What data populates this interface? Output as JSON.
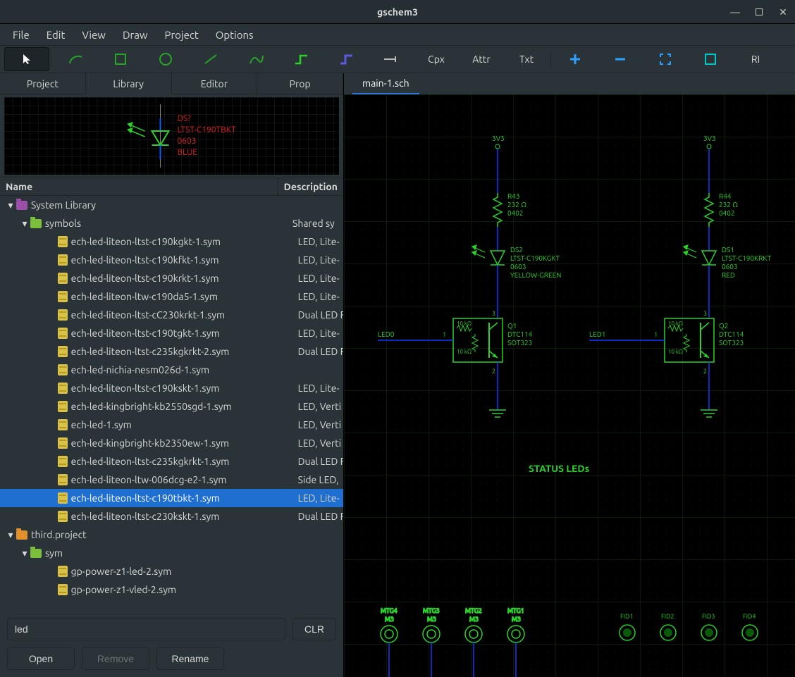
{
  "window": {
    "title": "gschem3"
  },
  "menu": [
    "File",
    "Edit",
    "View",
    "Draw",
    "Project",
    "Options"
  ],
  "toolbar_text": {
    "cpx": "Cpx",
    "attr": "Attr",
    "txt": "Txt",
    "ri": "RI"
  },
  "left_tabs": [
    "Project",
    "Library",
    "Editor",
    "Prop"
  ],
  "active_left_tab": 1,
  "preview": {
    "refdes": "DS?",
    "part": "LTST-C190TBKT",
    "footprint": "0603",
    "color": "BLUE"
  },
  "tree_columns": [
    "Name",
    "Description"
  ],
  "tree": [
    {
      "indent": 0,
      "icon": "folder-purple",
      "twisty": "▾",
      "label": "System Library",
      "desc": ""
    },
    {
      "indent": 1,
      "icon": "folder-green",
      "twisty": "▾",
      "label": "symbols",
      "desc": "Shared sy"
    },
    {
      "indent": 2,
      "icon": "file-sym",
      "label": "ech-led-liteon-ltst-c190kgkt-1.sym",
      "desc": "LED, Lite-"
    },
    {
      "indent": 2,
      "icon": "file-sym",
      "label": "ech-led-liteon-ltst-c190kfkt-1.sym",
      "desc": "LED, Lite-"
    },
    {
      "indent": 2,
      "icon": "file-sym",
      "label": "ech-led-liteon-ltst-c190krkt-1.sym",
      "desc": "LED, Lite-"
    },
    {
      "indent": 2,
      "icon": "file-sym",
      "label": "ech-led-liteon-ltw-c190da5-1.sym",
      "desc": "LED, Lite-"
    },
    {
      "indent": 2,
      "icon": "file-sym",
      "label": "ech-led-liteon-ltst-cC230krkt-1.sym",
      "desc": "Dual LED F"
    },
    {
      "indent": 2,
      "icon": "file-sym",
      "label": "ech-led-liteon-ltst-c190tgkt-1.sym",
      "desc": "LED, Lite-"
    },
    {
      "indent": 2,
      "icon": "file-sym",
      "label": "ech-led-liteon-ltst-c235kgkrkt-2.sym",
      "desc": "Dual LED F"
    },
    {
      "indent": 2,
      "icon": "file-sym",
      "label": "ech-led-nichia-nesm026d-1.sym",
      "desc": ""
    },
    {
      "indent": 2,
      "icon": "file-sym",
      "label": "ech-led-liteon-ltst-c190kskt-1.sym",
      "desc": "LED, Lite-"
    },
    {
      "indent": 2,
      "icon": "file-sym",
      "label": "ech-led-kingbright-kb2550sgd-1.sym",
      "desc": "LED, Verti"
    },
    {
      "indent": 2,
      "icon": "file-sym",
      "label": "ech-led-1.sym",
      "desc": "LED, Verti"
    },
    {
      "indent": 2,
      "icon": "file-sym",
      "label": "ech-led-kingbright-kb2350ew-1.sym",
      "desc": "LED, Verti"
    },
    {
      "indent": 2,
      "icon": "file-sym",
      "label": "ech-led-liteon-ltst-c235kgkrkt-1.sym",
      "desc": "Dual LED F"
    },
    {
      "indent": 2,
      "icon": "file-sym",
      "label": "ech-led-liteon-ltw-006dcg-e2-1.sym",
      "desc": "Side LED, "
    },
    {
      "indent": 2,
      "icon": "file-sym",
      "label": "ech-led-liteon-ltst-c190tbkt-1.sym",
      "desc": "LED, Lite-",
      "selected": true
    },
    {
      "indent": 2,
      "icon": "file-sym",
      "label": "ech-led-liteon-ltst-c230kskt-1.sym",
      "desc": "Dual LED F"
    },
    {
      "indent": 0,
      "icon": "folder-orange",
      "twisty": "▾",
      "label": "third.project",
      "desc": ""
    },
    {
      "indent": 1,
      "icon": "folder-green",
      "twisty": "▾",
      "label": "sym",
      "desc": ""
    },
    {
      "indent": 2,
      "icon": "file-sym",
      "label": "gp-power-z1-led-2.sym",
      "desc": ""
    },
    {
      "indent": 2,
      "icon": "file-sym",
      "label": "gp-power-z1-vled-2.sym",
      "desc": ""
    }
  ],
  "search_value": "led",
  "buttons": {
    "clear": "CLR",
    "open": "Open",
    "remove": "Remove",
    "rename": "Rename"
  },
  "doc_tab": "main-1.sch",
  "schematic": {
    "rail": "3V3",
    "r43": {
      "ref": "R43",
      "val": "232 Ω",
      "fp": "0402"
    },
    "r44": {
      "ref": "R44",
      "val": "232 Ω",
      "fp": "0402"
    },
    "ds2": {
      "ref": "DS2",
      "part": "LTST-C190KGKT",
      "fp": "0603",
      "color": "YELLOW-GREEN"
    },
    "ds1": {
      "ref": "DS1",
      "part": "LTST-C190KRKT",
      "fp": "0603",
      "color": "RED"
    },
    "q1": {
      "ref": "Q1",
      "part": "DTC114",
      "fp": "SOT323",
      "r1": "10 kΩ",
      "r2": "10 kΩ"
    },
    "q2": {
      "ref": "Q2",
      "part": "DTC114",
      "fp": "SOT323",
      "r1": "10 kΩ",
      "r2": "10 kΩ"
    },
    "net_led0": "LED0",
    "net_led1": "LED1",
    "pin1": "1",
    "pin2": "2",
    "pin3": "3",
    "title": "STATUS LEDs",
    "mtg": [
      {
        "ref": "MTG4",
        "val": "M3"
      },
      {
        "ref": "MTG3",
        "val": "M3"
      },
      {
        "ref": "MTG2",
        "val": "M3"
      },
      {
        "ref": "MTG1",
        "val": "M3"
      }
    ],
    "fid": [
      "FID1",
      "FID2",
      "FID3",
      "FID4"
    ]
  }
}
